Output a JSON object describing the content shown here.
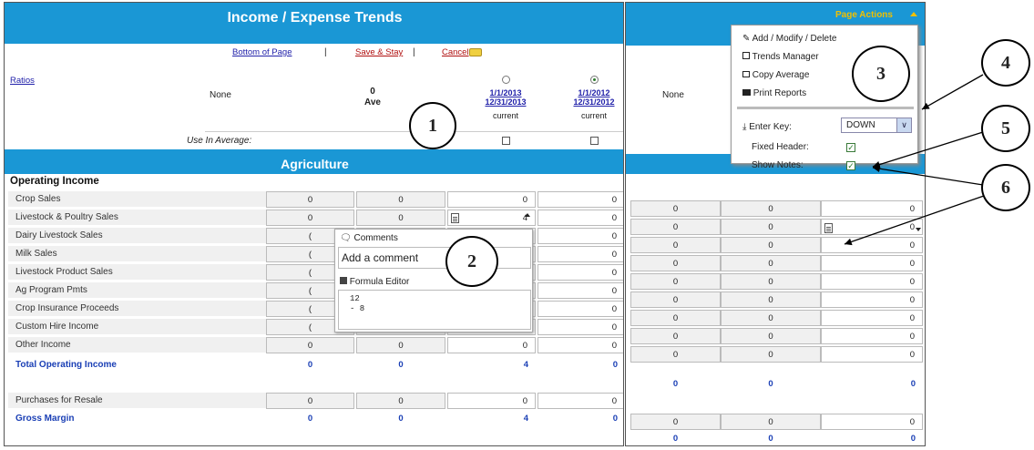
{
  "header": {
    "title": "Income / Expense Trends",
    "page_actions": "Page Actions"
  },
  "toolbar": {
    "bottom_of_page": "Bottom of Page",
    "sep": "|",
    "save_stay": "Save & Stay",
    "cancel": "Cancel"
  },
  "ratios": "Ratios",
  "columns": {
    "none": "None",
    "avg_partial_1": "0",
    "avg_partial_2": "Ave",
    "col3": {
      "start": "1/1/2013",
      "end": "12/31/2013",
      "status": "current"
    },
    "col4": {
      "start": "1/1/2012",
      "end": "12/31/2012",
      "status": "current"
    }
  },
  "use_in_average": "Use In Average:",
  "section": "Agriculture",
  "group": "Operating Income",
  "rows": [
    {
      "label": "Crop Sales",
      "v": [
        "0",
        "0",
        "0",
        "0"
      ]
    },
    {
      "label": "Livestock & Poultry Sales",
      "v": [
        "0",
        "0",
        "4",
        "0"
      ]
    },
    {
      "label": "Dairy Livestock Sales",
      "v": [
        "(",
        "",
        "",
        "0"
      ]
    },
    {
      "label": "Milk Sales",
      "v": [
        "(",
        "",
        "",
        "0"
      ]
    },
    {
      "label": "Livestock Product Sales",
      "v": [
        "(",
        "",
        "",
        "0"
      ]
    },
    {
      "label": "Ag Program Pmts",
      "v": [
        "(",
        "",
        "",
        "0"
      ]
    },
    {
      "label": "Crop Insurance Proceeds",
      "v": [
        "(",
        "",
        "",
        "0"
      ]
    },
    {
      "label": "Custom Hire Income",
      "v": [
        "(",
        "",
        "",
        "0"
      ]
    },
    {
      "label": "Other Income",
      "v": [
        "0",
        "0",
        "0",
        "0"
      ]
    }
  ],
  "total_operating": {
    "label": "Total Operating Income",
    "v": [
      "0",
      "0",
      "4",
      "0"
    ]
  },
  "purchases": {
    "label": "Purchases for Resale",
    "v": [
      "0",
      "0",
      "0",
      "0"
    ]
  },
  "gross_margin": {
    "label": "Gross Margin",
    "v": [
      "0",
      "0",
      "4",
      "0"
    ]
  },
  "popup": {
    "comments": "Comments",
    "placeholder": "Add a comment",
    "formula_editor": "Formula Editor",
    "formula": [
      "12",
      "- 8"
    ]
  },
  "right": {
    "none": "None",
    "rows": [
      [
        "0",
        "0",
        "0"
      ],
      [
        "0",
        "0",
        "0"
      ],
      [
        "0",
        "0",
        "0"
      ],
      [
        "0",
        "0",
        "0"
      ],
      [
        "0",
        "0",
        "0"
      ],
      [
        "0",
        "0",
        "0"
      ],
      [
        "0",
        "0",
        "0"
      ],
      [
        "0",
        "0",
        "0"
      ],
      [
        "0",
        "0",
        "0"
      ]
    ],
    "total": [
      "0",
      "0",
      "0"
    ],
    "purchases": [
      "0",
      "0",
      "0"
    ],
    "gross": [
      "0",
      "0",
      "0"
    ]
  },
  "menu": {
    "items": [
      "Add / Modify / Delete",
      "Trends Manager",
      "Copy Average",
      "Print Reports"
    ],
    "enter_key": "Enter Key:",
    "enter_value": "DOWN",
    "fixed_header": "Fixed Header:",
    "show_notes": "Show Notes:"
  },
  "callouts": [
    "1",
    "2",
    "3",
    "4",
    "5",
    "6"
  ],
  "colors": {
    "header": "#1a97d5",
    "total_text": "#1a3fb5",
    "link_red": "#b01010"
  }
}
